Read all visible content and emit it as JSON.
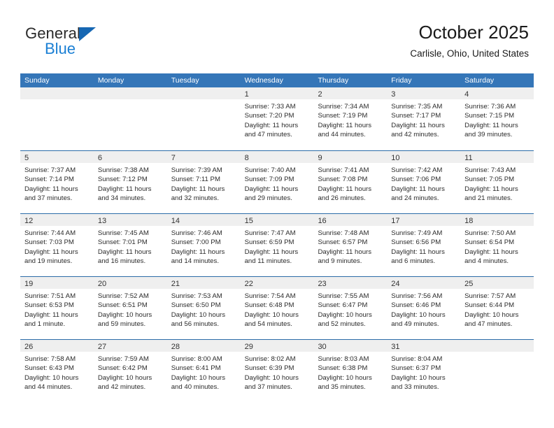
{
  "brand": {
    "name_top": "General",
    "name_bottom": "Blue",
    "triangle_color": "#1667b3",
    "blue_color": "#1a7fd4"
  },
  "header": {
    "title": "October 2025",
    "location": "Carlisle, Ohio, United States"
  },
  "theme": {
    "header_band": "#3576b8",
    "week_divider": "#2c6ca8",
    "day_strip": "#efefef",
    "cell_bg": "#ffffff",
    "text": "#2b2b2b"
  },
  "weekdays": [
    "Sunday",
    "Monday",
    "Tuesday",
    "Wednesday",
    "Thursday",
    "Friday",
    "Saturday"
  ],
  "weeks": [
    [
      {
        "day": "",
        "sunrise": "",
        "sunset": "",
        "daylight_1": "",
        "daylight_2": ""
      },
      {
        "day": "",
        "sunrise": "",
        "sunset": "",
        "daylight_1": "",
        "daylight_2": ""
      },
      {
        "day": "",
        "sunrise": "",
        "sunset": "",
        "daylight_1": "",
        "daylight_2": ""
      },
      {
        "day": "1",
        "sunrise": "Sunrise: 7:33 AM",
        "sunset": "Sunset: 7:20 PM",
        "daylight_1": "Daylight: 11 hours",
        "daylight_2": "and 47 minutes."
      },
      {
        "day": "2",
        "sunrise": "Sunrise: 7:34 AM",
        "sunset": "Sunset: 7:19 PM",
        "daylight_1": "Daylight: 11 hours",
        "daylight_2": "and 44 minutes."
      },
      {
        "day": "3",
        "sunrise": "Sunrise: 7:35 AM",
        "sunset": "Sunset: 7:17 PM",
        "daylight_1": "Daylight: 11 hours",
        "daylight_2": "and 42 minutes."
      },
      {
        "day": "4",
        "sunrise": "Sunrise: 7:36 AM",
        "sunset": "Sunset: 7:15 PM",
        "daylight_1": "Daylight: 11 hours",
        "daylight_2": "and 39 minutes."
      }
    ],
    [
      {
        "day": "5",
        "sunrise": "Sunrise: 7:37 AM",
        "sunset": "Sunset: 7:14 PM",
        "daylight_1": "Daylight: 11 hours",
        "daylight_2": "and 37 minutes."
      },
      {
        "day": "6",
        "sunrise": "Sunrise: 7:38 AM",
        "sunset": "Sunset: 7:12 PM",
        "daylight_1": "Daylight: 11 hours",
        "daylight_2": "and 34 minutes."
      },
      {
        "day": "7",
        "sunrise": "Sunrise: 7:39 AM",
        "sunset": "Sunset: 7:11 PM",
        "daylight_1": "Daylight: 11 hours",
        "daylight_2": "and 32 minutes."
      },
      {
        "day": "8",
        "sunrise": "Sunrise: 7:40 AM",
        "sunset": "Sunset: 7:09 PM",
        "daylight_1": "Daylight: 11 hours",
        "daylight_2": "and 29 minutes."
      },
      {
        "day": "9",
        "sunrise": "Sunrise: 7:41 AM",
        "sunset": "Sunset: 7:08 PM",
        "daylight_1": "Daylight: 11 hours",
        "daylight_2": "and 26 minutes."
      },
      {
        "day": "10",
        "sunrise": "Sunrise: 7:42 AM",
        "sunset": "Sunset: 7:06 PM",
        "daylight_1": "Daylight: 11 hours",
        "daylight_2": "and 24 minutes."
      },
      {
        "day": "11",
        "sunrise": "Sunrise: 7:43 AM",
        "sunset": "Sunset: 7:05 PM",
        "daylight_1": "Daylight: 11 hours",
        "daylight_2": "and 21 minutes."
      }
    ],
    [
      {
        "day": "12",
        "sunrise": "Sunrise: 7:44 AM",
        "sunset": "Sunset: 7:03 PM",
        "daylight_1": "Daylight: 11 hours",
        "daylight_2": "and 19 minutes."
      },
      {
        "day": "13",
        "sunrise": "Sunrise: 7:45 AM",
        "sunset": "Sunset: 7:01 PM",
        "daylight_1": "Daylight: 11 hours",
        "daylight_2": "and 16 minutes."
      },
      {
        "day": "14",
        "sunrise": "Sunrise: 7:46 AM",
        "sunset": "Sunset: 7:00 PM",
        "daylight_1": "Daylight: 11 hours",
        "daylight_2": "and 14 minutes."
      },
      {
        "day": "15",
        "sunrise": "Sunrise: 7:47 AM",
        "sunset": "Sunset: 6:59 PM",
        "daylight_1": "Daylight: 11 hours",
        "daylight_2": "and 11 minutes."
      },
      {
        "day": "16",
        "sunrise": "Sunrise: 7:48 AM",
        "sunset": "Sunset: 6:57 PM",
        "daylight_1": "Daylight: 11 hours",
        "daylight_2": "and 9 minutes."
      },
      {
        "day": "17",
        "sunrise": "Sunrise: 7:49 AM",
        "sunset": "Sunset: 6:56 PM",
        "daylight_1": "Daylight: 11 hours",
        "daylight_2": "and 6 minutes."
      },
      {
        "day": "18",
        "sunrise": "Sunrise: 7:50 AM",
        "sunset": "Sunset: 6:54 PM",
        "daylight_1": "Daylight: 11 hours",
        "daylight_2": "and 4 minutes."
      }
    ],
    [
      {
        "day": "19",
        "sunrise": "Sunrise: 7:51 AM",
        "sunset": "Sunset: 6:53 PM",
        "daylight_1": "Daylight: 11 hours",
        "daylight_2": "and 1 minute."
      },
      {
        "day": "20",
        "sunrise": "Sunrise: 7:52 AM",
        "sunset": "Sunset: 6:51 PM",
        "daylight_1": "Daylight: 10 hours",
        "daylight_2": "and 59 minutes."
      },
      {
        "day": "21",
        "sunrise": "Sunrise: 7:53 AM",
        "sunset": "Sunset: 6:50 PM",
        "daylight_1": "Daylight: 10 hours",
        "daylight_2": "and 56 minutes."
      },
      {
        "day": "22",
        "sunrise": "Sunrise: 7:54 AM",
        "sunset": "Sunset: 6:48 PM",
        "daylight_1": "Daylight: 10 hours",
        "daylight_2": "and 54 minutes."
      },
      {
        "day": "23",
        "sunrise": "Sunrise: 7:55 AM",
        "sunset": "Sunset: 6:47 PM",
        "daylight_1": "Daylight: 10 hours",
        "daylight_2": "and 52 minutes."
      },
      {
        "day": "24",
        "sunrise": "Sunrise: 7:56 AM",
        "sunset": "Sunset: 6:46 PM",
        "daylight_1": "Daylight: 10 hours",
        "daylight_2": "and 49 minutes."
      },
      {
        "day": "25",
        "sunrise": "Sunrise: 7:57 AM",
        "sunset": "Sunset: 6:44 PM",
        "daylight_1": "Daylight: 10 hours",
        "daylight_2": "and 47 minutes."
      }
    ],
    [
      {
        "day": "26",
        "sunrise": "Sunrise: 7:58 AM",
        "sunset": "Sunset: 6:43 PM",
        "daylight_1": "Daylight: 10 hours",
        "daylight_2": "and 44 minutes."
      },
      {
        "day": "27",
        "sunrise": "Sunrise: 7:59 AM",
        "sunset": "Sunset: 6:42 PM",
        "daylight_1": "Daylight: 10 hours",
        "daylight_2": "and 42 minutes."
      },
      {
        "day": "28",
        "sunrise": "Sunrise: 8:00 AM",
        "sunset": "Sunset: 6:41 PM",
        "daylight_1": "Daylight: 10 hours",
        "daylight_2": "and 40 minutes."
      },
      {
        "day": "29",
        "sunrise": "Sunrise: 8:02 AM",
        "sunset": "Sunset: 6:39 PM",
        "daylight_1": "Daylight: 10 hours",
        "daylight_2": "and 37 minutes."
      },
      {
        "day": "30",
        "sunrise": "Sunrise: 8:03 AM",
        "sunset": "Sunset: 6:38 PM",
        "daylight_1": "Daylight: 10 hours",
        "daylight_2": "and 35 minutes."
      },
      {
        "day": "31",
        "sunrise": "Sunrise: 8:04 AM",
        "sunset": "Sunset: 6:37 PM",
        "daylight_1": "Daylight: 10 hours",
        "daylight_2": "and 33 minutes."
      },
      {
        "day": "",
        "sunrise": "",
        "sunset": "",
        "daylight_1": "",
        "daylight_2": ""
      }
    ]
  ]
}
